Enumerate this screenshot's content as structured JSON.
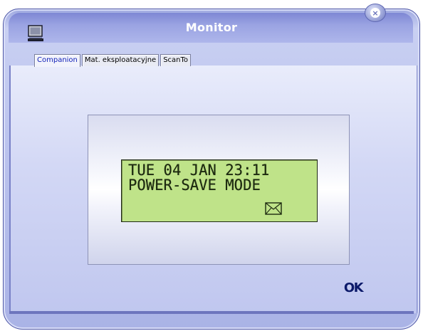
{
  "window": {
    "title": "Monitor",
    "close_label": "×"
  },
  "tabs": [
    {
      "label": "Companion",
      "active": true
    },
    {
      "label": "Mat. eksploatacyjne",
      "active": false
    },
    {
      "label": "ScanTo",
      "active": false
    }
  ],
  "display": {
    "line1": "TUE 04 JAN 23:11",
    "line2": "POWER-SAVE MODE",
    "icon": "envelope-icon",
    "background_color": "#bfe389"
  },
  "buttons": {
    "ok_label": "OK"
  },
  "colors": {
    "frame": "#aab3e6",
    "title_text": "#ffffff",
    "active_tab_text": "#0f1fb8",
    "ok_text": "#0c1a6a"
  }
}
